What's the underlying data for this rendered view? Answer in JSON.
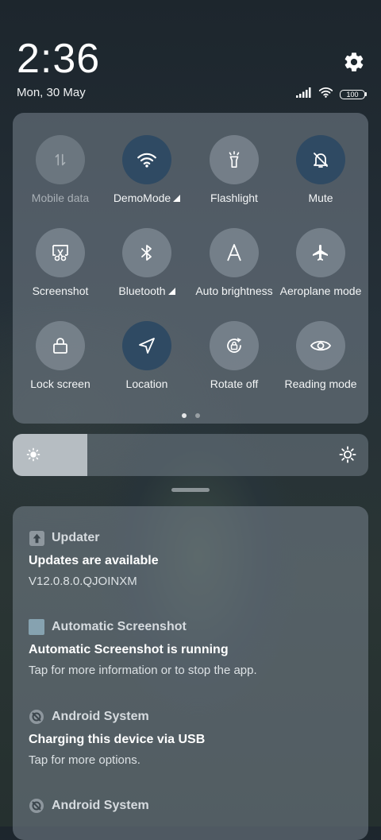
{
  "status_bar": {
    "time": "2:36",
    "date": "Mon, 30 May",
    "battery": "100",
    "icons": [
      "signal-icon",
      "wifi-icon",
      "battery-icon"
    ]
  },
  "quick_settings": {
    "tiles": [
      {
        "label": "Mobile data",
        "icon": "mobile-data-icon",
        "state": "unavailable"
      },
      {
        "label": "DemoMode",
        "icon": "wifi-icon",
        "state": "on",
        "has_expand": true
      },
      {
        "label": "Flashlight",
        "icon": "flashlight-icon",
        "state": "off"
      },
      {
        "label": "Mute",
        "icon": "bell-off-icon",
        "state": "on"
      },
      {
        "label": "Screenshot",
        "icon": "screenshot-icon",
        "state": "off"
      },
      {
        "label": "Bluetooth",
        "icon": "bluetooth-icon",
        "state": "off",
        "has_expand": true
      },
      {
        "label": "Auto brightness",
        "icon": "auto-brightness-icon",
        "state": "off"
      },
      {
        "label": "Aeroplane mode",
        "icon": "aeroplane-icon",
        "state": "off"
      },
      {
        "label": "Lock screen",
        "icon": "lock-icon",
        "state": "off"
      },
      {
        "label": "Location",
        "icon": "location-icon",
        "state": "on"
      },
      {
        "label": "Rotate off",
        "icon": "rotate-lock-icon",
        "state": "off"
      },
      {
        "label": "Reading mode",
        "icon": "eye-icon",
        "state": "off"
      }
    ],
    "page_indicator": {
      "pages": 2,
      "current": 1
    }
  },
  "brightness": {
    "level": 0.21
  },
  "notifications": [
    {
      "app": "Updater",
      "icon": "updater-icon",
      "title": "Updates are available",
      "body": "V12.0.8.0.QJOINXM"
    },
    {
      "app": "Automatic Screenshot",
      "icon": "app-square-icon",
      "title": "Automatic Screenshot is running",
      "body": "Tap for more information or to stop the app."
    },
    {
      "app": "Android System",
      "icon": "android-system-icon",
      "title": "Charging this device via USB",
      "body": "Tap for more options."
    },
    {
      "app": "Android System",
      "icon": "android-system-icon",
      "title": "",
      "body": ""
    }
  ],
  "colors": {
    "active_tile": "#2f4a63",
    "panel": "#78848e"
  }
}
